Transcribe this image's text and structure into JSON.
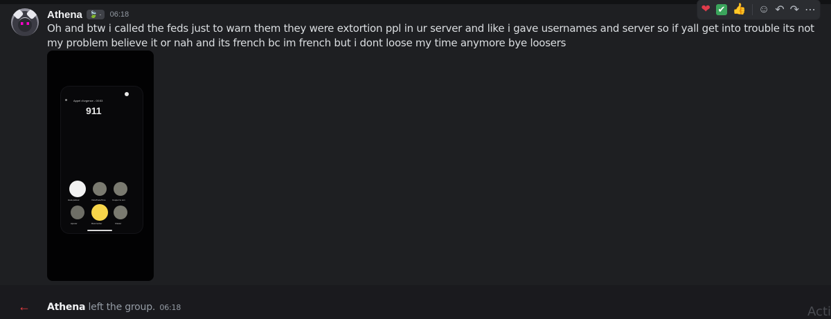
{
  "message": {
    "author": "Athena",
    "badge_text": "·",
    "timestamp": "06:18",
    "text": "Oh and btw i called the feds just to warn them they were extortion ppl in ur server and like i gave usernames and server so if yall get into trouble its not my problem believe it or nah and its french bc im french but i dont loose my time anymore bye loosers",
    "attachment": {
      "call_label": "Appel d'urgence - 00:53",
      "call_number": "911",
      "buttons": [
        "Haut-parleur",
        "Visio/FaceTime",
        "Couper le son",
        "Ajouter",
        "Raccrocher",
        "Clavier"
      ]
    }
  },
  "reactions": {
    "items": [
      "heart",
      "check",
      "thumbs-up"
    ],
    "controls": [
      "add-reaction",
      "reply",
      "forward",
      "more"
    ]
  },
  "system_message": {
    "name": "Athena",
    "text": "left the group.",
    "timestamp": "06:18"
  },
  "watermark": "Acti",
  "colors": {
    "background": "#1e1f22",
    "accent_red": "#f23f43",
    "check_green": "#3ba55c",
    "heart_red": "#e03c4b"
  }
}
